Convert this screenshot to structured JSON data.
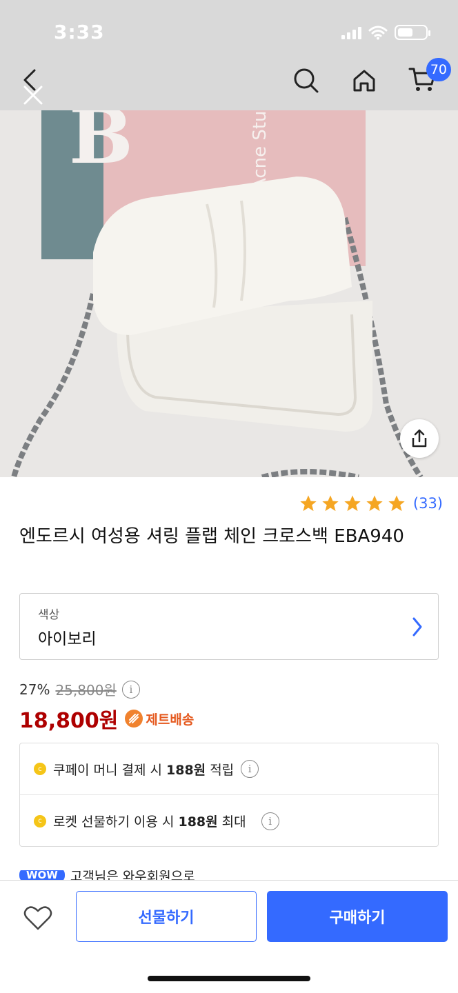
{
  "status_bar": {
    "time": "3:33"
  },
  "nav": {
    "cart_count": "70"
  },
  "product": {
    "review_count": "(33)",
    "title": "엔도르시 여성용 셔링 플랩 체인 크로스백 EBA940",
    "image_texts": {
      "book_letter": "B",
      "book_brand": "Acne Stud"
    }
  },
  "option": {
    "label": "색상",
    "value": "아이보리"
  },
  "pricing": {
    "discount_rate": "27%",
    "original_price": "25,800원",
    "sale_price": "18,800원",
    "delivery_label": "제트배송"
  },
  "benefits": [
    {
      "prefix": "쿠페이 머니 결제 시 ",
      "amount": "188원",
      "suffix": " 적립"
    },
    {
      "prefix": "로켓 선물하기 이용 시 ",
      "amount": "188원",
      "suffix": " 최대"
    }
  ],
  "peek": {
    "badge": "WOW",
    "text": "고객님은 와우회원으로"
  },
  "bottom_bar": {
    "gift_label": "선물하기",
    "buy_label": "구매하기"
  },
  "colors": {
    "accent": "#346aff",
    "price": "#ae0000",
    "star": "#f5a623",
    "jet": "#e5591e"
  },
  "icons": [
    "back-icon",
    "close-icon",
    "search-icon",
    "home-icon",
    "cart-icon",
    "share-icon",
    "star-icon",
    "chevron-right-icon",
    "info-icon",
    "coin-icon",
    "heart-icon",
    "jet-delivery-icon"
  ]
}
